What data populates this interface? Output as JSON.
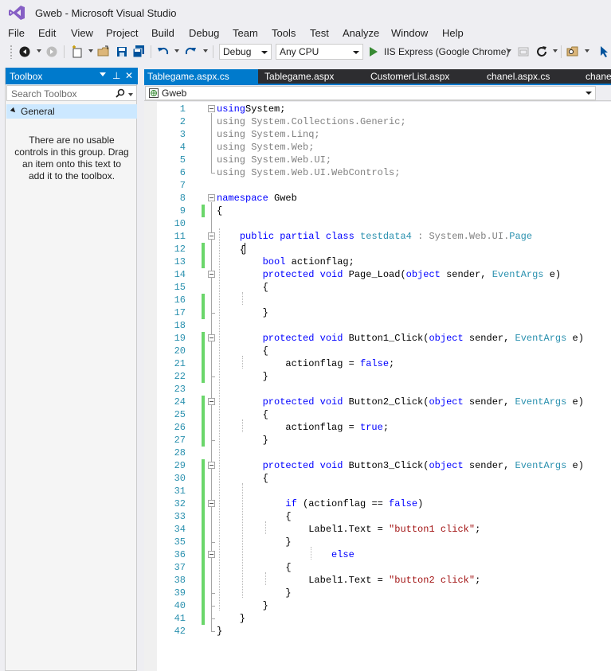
{
  "window": {
    "title": "Gweb - Microsoft Visual Studio"
  },
  "menu": [
    "File",
    "Edit",
    "View",
    "Project",
    "Build",
    "Debug",
    "Team",
    "Tools",
    "Test",
    "Analyze",
    "Window",
    "Help"
  ],
  "toolbar": {
    "configuration": "Debug",
    "platform": "Any CPU",
    "run_label": "IIS Express (Google Chrome)"
  },
  "toolbox": {
    "title": "Toolbox",
    "search_placeholder": "Search Toolbox",
    "group": "General",
    "empty_message": "There are no usable controls in this group. Drag an item onto this text to add it to the toolbox."
  },
  "tabs": [
    {
      "label": "Tablegame.aspx.cs",
      "active": true
    },
    {
      "label": "Tablegame.aspx",
      "active": false
    },
    {
      "label": "CustomerList.aspx",
      "active": false
    },
    {
      "label": "chanel.aspx.cs",
      "active": false
    },
    {
      "label": "chanel",
      "active": false
    }
  ],
  "navbar": {
    "project": "Gweb"
  },
  "colors": {
    "accent": "#007acc",
    "keyword": "#0000ff",
    "type": "#2b91af",
    "string": "#a31515",
    "changed_margin": "#6bd66b"
  },
  "code_lines": [
    [
      [
        "kw",
        "using"
      ],
      [
        "",
        "System;"
      ]
    ],
    [
      [
        "gray",
        "using System.Collections.Generic;"
      ]
    ],
    [
      [
        "gray",
        "using System.Linq;"
      ]
    ],
    [
      [
        "gray",
        "using System.Web;"
      ]
    ],
    [
      [
        "gray",
        "using System.Web.UI;"
      ]
    ],
    [
      [
        "gray",
        "using System.Web.UI.WebControls;"
      ]
    ],
    [],
    [
      [
        "kw",
        "namespace"
      ],
      [
        "",
        " Gweb"
      ]
    ],
    [
      [
        "",
        "{"
      ]
    ],
    [],
    [
      [
        "",
        "    "
      ],
      [
        "kw",
        "public partial class"
      ],
      [
        "",
        " "
      ],
      [
        "type",
        "testdata4"
      ],
      [
        "",
        " "
      ],
      [
        "gray",
        ": System.Web.UI."
      ],
      [
        "type",
        "Page"
      ]
    ],
    [
      [
        "",
        "    {"
      ],
      [
        "caret",
        ""
      ]
    ],
    [
      [
        "",
        "        "
      ],
      [
        "kw",
        "bool"
      ],
      [
        "",
        " actionflag;"
      ]
    ],
    [
      [
        "",
        "        "
      ],
      [
        "kw",
        "protected void"
      ],
      [
        "",
        " Page_Load("
      ],
      [
        "kw",
        "object"
      ],
      [
        "",
        " sender, "
      ],
      [
        "type",
        "EventArgs"
      ],
      [
        "",
        " e)"
      ]
    ],
    [
      [
        "",
        "        {"
      ]
    ],
    [],
    [
      [
        "",
        "        }"
      ]
    ],
    [],
    [
      [
        "",
        "        "
      ],
      [
        "kw",
        "protected void"
      ],
      [
        "",
        " Button1_Click("
      ],
      [
        "kw",
        "object"
      ],
      [
        "",
        " sender, "
      ],
      [
        "type",
        "EventArgs"
      ],
      [
        "",
        " e)"
      ]
    ],
    [
      [
        "",
        "        {"
      ]
    ],
    [
      [
        "",
        "            actionflag = "
      ],
      [
        "kw",
        "false"
      ],
      [
        "",
        ";"
      ]
    ],
    [
      [
        "",
        "        }"
      ]
    ],
    [],
    [
      [
        "",
        "        "
      ],
      [
        "kw",
        "protected void"
      ],
      [
        "",
        " Button2_Click("
      ],
      [
        "kw",
        "object"
      ],
      [
        "",
        " sender, "
      ],
      [
        "type",
        "EventArgs"
      ],
      [
        "",
        " e)"
      ]
    ],
    [
      [
        "",
        "        {"
      ]
    ],
    [
      [
        "",
        "            actionflag = "
      ],
      [
        "kw",
        "true"
      ],
      [
        "",
        ";"
      ]
    ],
    [
      [
        "",
        "        }"
      ]
    ],
    [],
    [
      [
        "",
        "        "
      ],
      [
        "kw",
        "protected void"
      ],
      [
        "",
        " Button3_Click("
      ],
      [
        "kw",
        "object"
      ],
      [
        "",
        " sender, "
      ],
      [
        "type",
        "EventArgs"
      ],
      [
        "",
        " e)"
      ]
    ],
    [
      [
        "",
        "        {"
      ]
    ],
    [],
    [
      [
        "",
        "            "
      ],
      [
        "kw",
        "if"
      ],
      [
        "",
        " (actionflag == "
      ],
      [
        "kw",
        "false"
      ],
      [
        "",
        ")"
      ]
    ],
    [
      [
        "",
        "            {"
      ]
    ],
    [
      [
        "",
        "                Label1.Text = "
      ],
      [
        "str",
        "\"button1 click\""
      ],
      [
        "",
        ";"
      ]
    ],
    [
      [
        "",
        "            }"
      ]
    ],
    [
      [
        "",
        "                    "
      ],
      [
        "kw",
        "else"
      ]
    ],
    [
      [
        "",
        "            {"
      ]
    ],
    [
      [
        "",
        "                Label1.Text = "
      ],
      [
        "str",
        "\"button2 click\""
      ],
      [
        "",
        ";"
      ]
    ],
    [
      [
        "",
        "            }"
      ]
    ],
    [
      [
        "",
        "        }"
      ]
    ],
    [
      [
        "",
        "    }"
      ]
    ],
    [
      [
        "",
        "}"
      ]
    ]
  ]
}
